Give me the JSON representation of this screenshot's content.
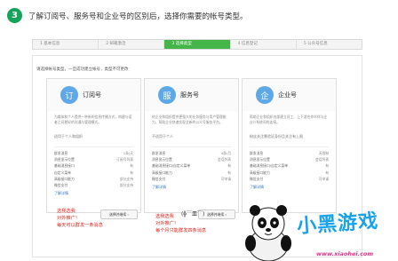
{
  "step": {
    "number": "3",
    "heading": "了解订阅号、服务号和企业号的区别后，选择你需要的帐号类型。"
  },
  "progress": {
    "steps": [
      {
        "label": "1 基本信息",
        "active": false
      },
      {
        "label": "2 邮箱激活",
        "active": false
      },
      {
        "label": "3 选择类型",
        "active": true
      },
      {
        "label": "4 信息登记",
        "active": false
      },
      {
        "label": "5 公众号信息",
        "active": false
      }
    ]
  },
  "instruction": "请选择帐号类型，一旦成功建立帐号，类型不可更改",
  "cards": [
    {
      "icon_text": "订",
      "name": "订阅号",
      "desc": "为媒体和个人提供一种新的信息传播方式，构建与读者之间更好的沟通与管理模式。",
      "target": "适用于个人和组织",
      "features": [
        {
          "k": "群发消息",
          "v": "1条/天"
        },
        {
          "k": "消息显示位置",
          "v": "订阅号列表"
        },
        {
          "k": "基础消息接口",
          "v": "有"
        },
        {
          "k": "自定义菜单",
          "v": "有"
        },
        {
          "k": "高级接口能力",
          "v": "部分支持"
        },
        {
          "k": "微信支付",
          "v": "部分支持"
        }
      ],
      "link": "了解详情",
      "select": "选择并继续 ›"
    },
    {
      "icon_text": "服",
      "name": "服务号",
      "desc": "给企业和组织提供更强大的业务服务与用户管理能力，帮助企业快速实现全新的公众号服务平台。",
      "target": "不适用于个人",
      "features": [
        {
          "k": "群发消息",
          "v": "4条/月"
        },
        {
          "k": "消息显示位置",
          "v": "会话列表"
        },
        {
          "k": "基础消息接口/自定义菜单",
          "v": "有"
        },
        {
          "k": "高级接口能力",
          "v": "有"
        },
        {
          "k": "微信支付",
          "v": "可申请"
        }
      ],
      "link": "了解详情",
      "select": "选择并继续 ›"
    },
    {
      "icon_text": "企",
      "name": "企业号",
      "desc": "帮助企业和组织内部建立员工、上下游合作伙伴与企业IT系统间的连接。",
      "target": "粉丝关注需验证身份且关注有上限",
      "features": [
        {
          "k": "群发消息",
          "v": "无限制"
        },
        {
          "k": "消息显示位置",
          "v": "会话列表"
        },
        {
          "k": "基础消息接口/自定义菜单",
          "v": "有"
        },
        {
          "k": "高级接口能力",
          "v": "有"
        },
        {
          "k": "微信支付",
          "v": "可申请"
        }
      ],
      "link": "了解详情",
      "select": "选择并继续 ›"
    }
  ],
  "notes": {
    "note1_line1": "选我选我",
    "note1_line2": "对外推广！",
    "note1_line3": "每天可以群发一条消息",
    "note2_line1": "选我选我",
    "note2_line2": "对外推广！",
    "note2_line3": "每个月只能群发四条消息",
    "face": "(╬￣皿￣)"
  },
  "watermark": {
    "title": "小黑游戏",
    "url": "www.xiaohei.com"
  },
  "colors": {
    "accent": "#44b549",
    "step_badge": "#14a35a",
    "note_red": "#e0251f",
    "link": "#3476c5",
    "logo_blue": "#1aa3e8",
    "logo_pink": "#e2348a"
  }
}
